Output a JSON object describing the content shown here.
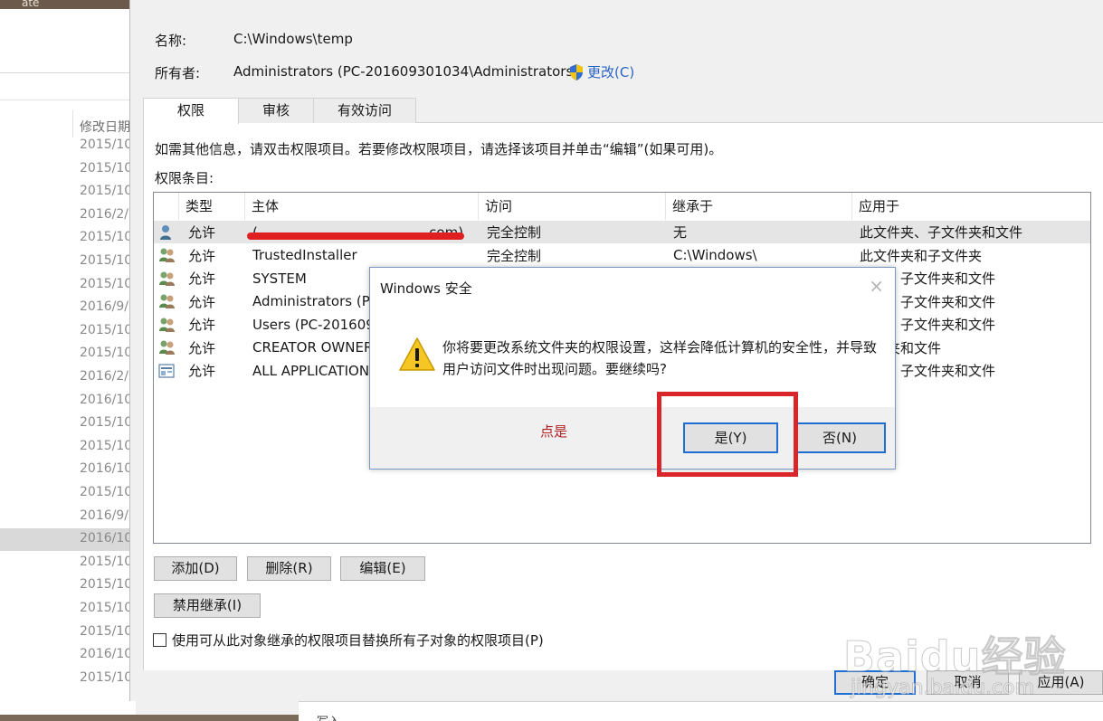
{
  "background_explorer": {
    "title_fragment": "ate",
    "column_header": "修改日期",
    "dates": [
      "2015/10",
      "2015/10",
      "2015/10",
      "2016/2/",
      "2015/10",
      "2015/10",
      "2015/10",
      "2016/9/",
      "2015/10",
      "2015/10",
      "2016/2/",
      "2016/10",
      "2015/10",
      "2015/10",
      "2016/10",
      "2015/10",
      "2016/9/",
      "2016/10",
      "2015/10",
      "2015/10",
      "2015/10",
      "2015/10",
      "2016/10",
      "2015/10"
    ],
    "bottom_fragment": "写入"
  },
  "header": {
    "name_label": "名称:",
    "name_value": "C:\\Windows\\temp",
    "owner_label": "所有者:",
    "owner_value": "Administrators (PC-201609301034\\Administrators)",
    "change_link": "更改(C)"
  },
  "tabs": [
    {
      "label": "权限",
      "active": true
    },
    {
      "label": "审核",
      "active": false
    },
    {
      "label": "有效访问",
      "active": false
    }
  ],
  "info_text": "如需其他信息，请双击权限项目。若要修改权限项目，请选择该项目并单击“编辑”(如果可用)。",
  "entries_label": "权限条目:",
  "permissions_table": {
    "columns": [
      "类型",
      "主体",
      "访问",
      "继承于",
      "应用于"
    ],
    "rows": [
      {
        "icon": "single-user-icon",
        "type": "允许",
        "principal": "(",
        "principal_tail": "...com)",
        "access": "完全控制",
        "inherited_from": "无",
        "applies_to": "此文件夹、子文件夹和文件",
        "selected": true,
        "redacted": true
      },
      {
        "icon": "user-group-icon",
        "type": "允许",
        "principal": "TrustedInstaller",
        "access": "完全控制",
        "inherited_from": "C:\\Windows\\",
        "applies_to": "此文件夹和子文件夹"
      },
      {
        "icon": "user-group-icon",
        "type": "允许",
        "principal": "SYSTEM",
        "access": "",
        "inherited_from": "",
        "applies_to": "件夹、子文件夹和文件"
      },
      {
        "icon": "user-group-icon",
        "type": "允许",
        "principal": "Administrators (PC",
        "access": "",
        "inherited_from": "",
        "applies_to": "件夹、子文件夹和文件"
      },
      {
        "icon": "user-group-icon",
        "type": "允许",
        "principal": "Users (PC-201609",
        "access": "",
        "inherited_from": "",
        "applies_to": "件夹、子文件夹和文件"
      },
      {
        "icon": "user-group-icon",
        "type": "允许",
        "principal": "CREATOR OWNER",
        "access": "",
        "inherited_from": "",
        "applies_to": "文件夹和文件"
      },
      {
        "icon": "app-package-icon",
        "type": "允许",
        "principal": "ALL APPLICATION",
        "access": "",
        "inherited_from": "",
        "applies_to": "件夹、子文件夹和文件"
      }
    ]
  },
  "buttons": {
    "add": "添加(D)",
    "remove": "删除(R)",
    "edit": "编辑(E)",
    "disable_inheritance": "禁用继承(I)",
    "ok": "确定",
    "cancel": "取消",
    "apply": "应用(A)"
  },
  "replace_checkbox_label": "使用可从此对象继承的权限项目替换所有子对象的权限项目(P)",
  "security_dialog": {
    "title": "Windows 安全",
    "message": "你将要更改系统文件夹的权限设置，这样会降低计算机的安全性，并导致用户访问文件时出现问题。要继续吗?",
    "yes": "是(Y)",
    "no": "否(N)",
    "annotation": "点是"
  },
  "watermark": {
    "brand": "Baidu经验",
    "url": "jingyan.baidu.com"
  },
  "colors": {
    "annotation_red": "#d8262a",
    "link_blue": "#2a64c5",
    "focus_blue": "#1e6fd4"
  }
}
